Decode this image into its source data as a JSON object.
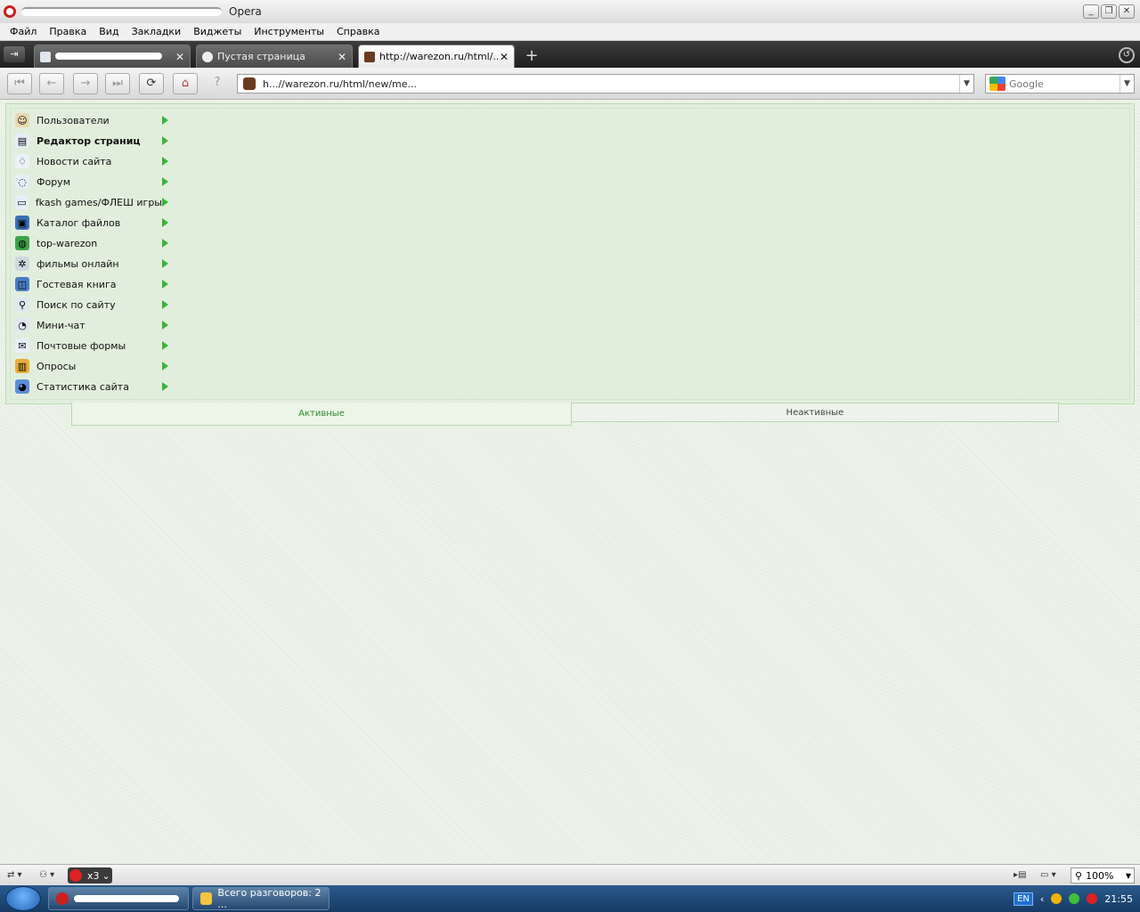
{
  "window": {
    "title": "Opera",
    "buttons": [
      "_",
      "❐",
      "✕"
    ]
  },
  "menubar": [
    "Файл",
    "Правка",
    "Вид",
    "Закладки",
    "Виджеты",
    "Инструменты",
    "Справка"
  ],
  "tabs": [
    {
      "label": "",
      "close": "✕"
    },
    {
      "label": "Пустая страница",
      "close": "✕"
    },
    {
      "label": "http://warezon.ru/html/...",
      "close": "✕"
    }
  ],
  "tabbar": {
    "new_tab": "+",
    "panel_toggle": "⇥",
    "trash": "↺"
  },
  "navbar": {
    "buttons": [
      "⏮",
      "←",
      "→",
      "⏭",
      "⟳",
      "⌂",
      "?"
    ],
    "address": "h...//warezon.ru/html/new/me...",
    "address_dropdown": "▼",
    "search_placeholder": "Google",
    "search_dropdown": "▼"
  },
  "menu": {
    "items": [
      {
        "label": "Пользователи",
        "icon": "user-icon",
        "glyph": "☺",
        "color": "#e9d9b0",
        "bold": false
      },
      {
        "label": "Редактор страниц",
        "icon": "page-icon",
        "glyph": "▤",
        "color": "#e6eef7",
        "bold": true
      },
      {
        "label": "Новости сайта",
        "icon": "lightbulb-icon",
        "glyph": "♢",
        "color": "#eaf2f8",
        "bold": false
      },
      {
        "label": "Форум",
        "icon": "chat-bubble-icon",
        "glyph": "◌",
        "color": "#e6eef7",
        "bold": false
      },
      {
        "label": "fkash games/ФЛЕШ игры",
        "icon": "document-icon",
        "glyph": "▭",
        "color": "#e6eef7",
        "bold": false
      },
      {
        "label": "Каталог файлов",
        "icon": "floppy-disk-icon",
        "glyph": "▣",
        "color": "#3a6fb5",
        "bold": false
      },
      {
        "label": "top-warezon",
        "icon": "globe-icon",
        "glyph": "◍",
        "color": "#3fa34a",
        "bold": false
      },
      {
        "label": "фильмы онлайн",
        "icon": "gear-icon",
        "glyph": "✲",
        "color": "#cfd8e0",
        "bold": false
      },
      {
        "label": "Гостевая книга",
        "icon": "book-icon",
        "glyph": "◫",
        "color": "#4a7ec4",
        "bold": false
      },
      {
        "label": "Поиск по сайту",
        "icon": "magnifier-icon",
        "glyph": "⚲",
        "color": "#dfe7ef",
        "bold": false
      },
      {
        "label": "Мини-чат",
        "icon": "chat-icon",
        "glyph": "◔",
        "color": "#dfe7ef",
        "bold": false
      },
      {
        "label": "Почтовые формы",
        "icon": "envelope-icon",
        "glyph": "✉",
        "color": "#e6eef7",
        "bold": false
      },
      {
        "label": "Опросы",
        "icon": "bar-chart-icon",
        "glyph": "▥",
        "color": "#e8ae3a",
        "bold": false
      },
      {
        "label": "Статистика сайта",
        "icon": "pie-chart-icon",
        "glyph": "◕",
        "color": "#5b8ed8",
        "bold": false
      }
    ]
  },
  "subtabs": {
    "active": "Активные",
    "inactive": "Неактивные"
  },
  "statusbar": {
    "left": "⇄ ▾",
    "share": "⚇ ▾",
    "unite": "x3",
    "unite_arrow": "⌄",
    "page_tools": "▸▤",
    "view": "▭ ▾",
    "zoom": "100%",
    "zoom_icon": "⚲",
    "zoom_drop": "▼"
  },
  "taskbar": {
    "tasks": [
      {
        "label": ""
      },
      {
        "label": "Всего разговоров: 2 ..."
      }
    ],
    "tray": {
      "lang": "EN",
      "time": "21:55",
      "arrow": "‹"
    }
  },
  "colors": {
    "accent_green": "#3db23d",
    "panel_border": "#b9dcb2",
    "active_tab_text": "#2e8b2e"
  }
}
